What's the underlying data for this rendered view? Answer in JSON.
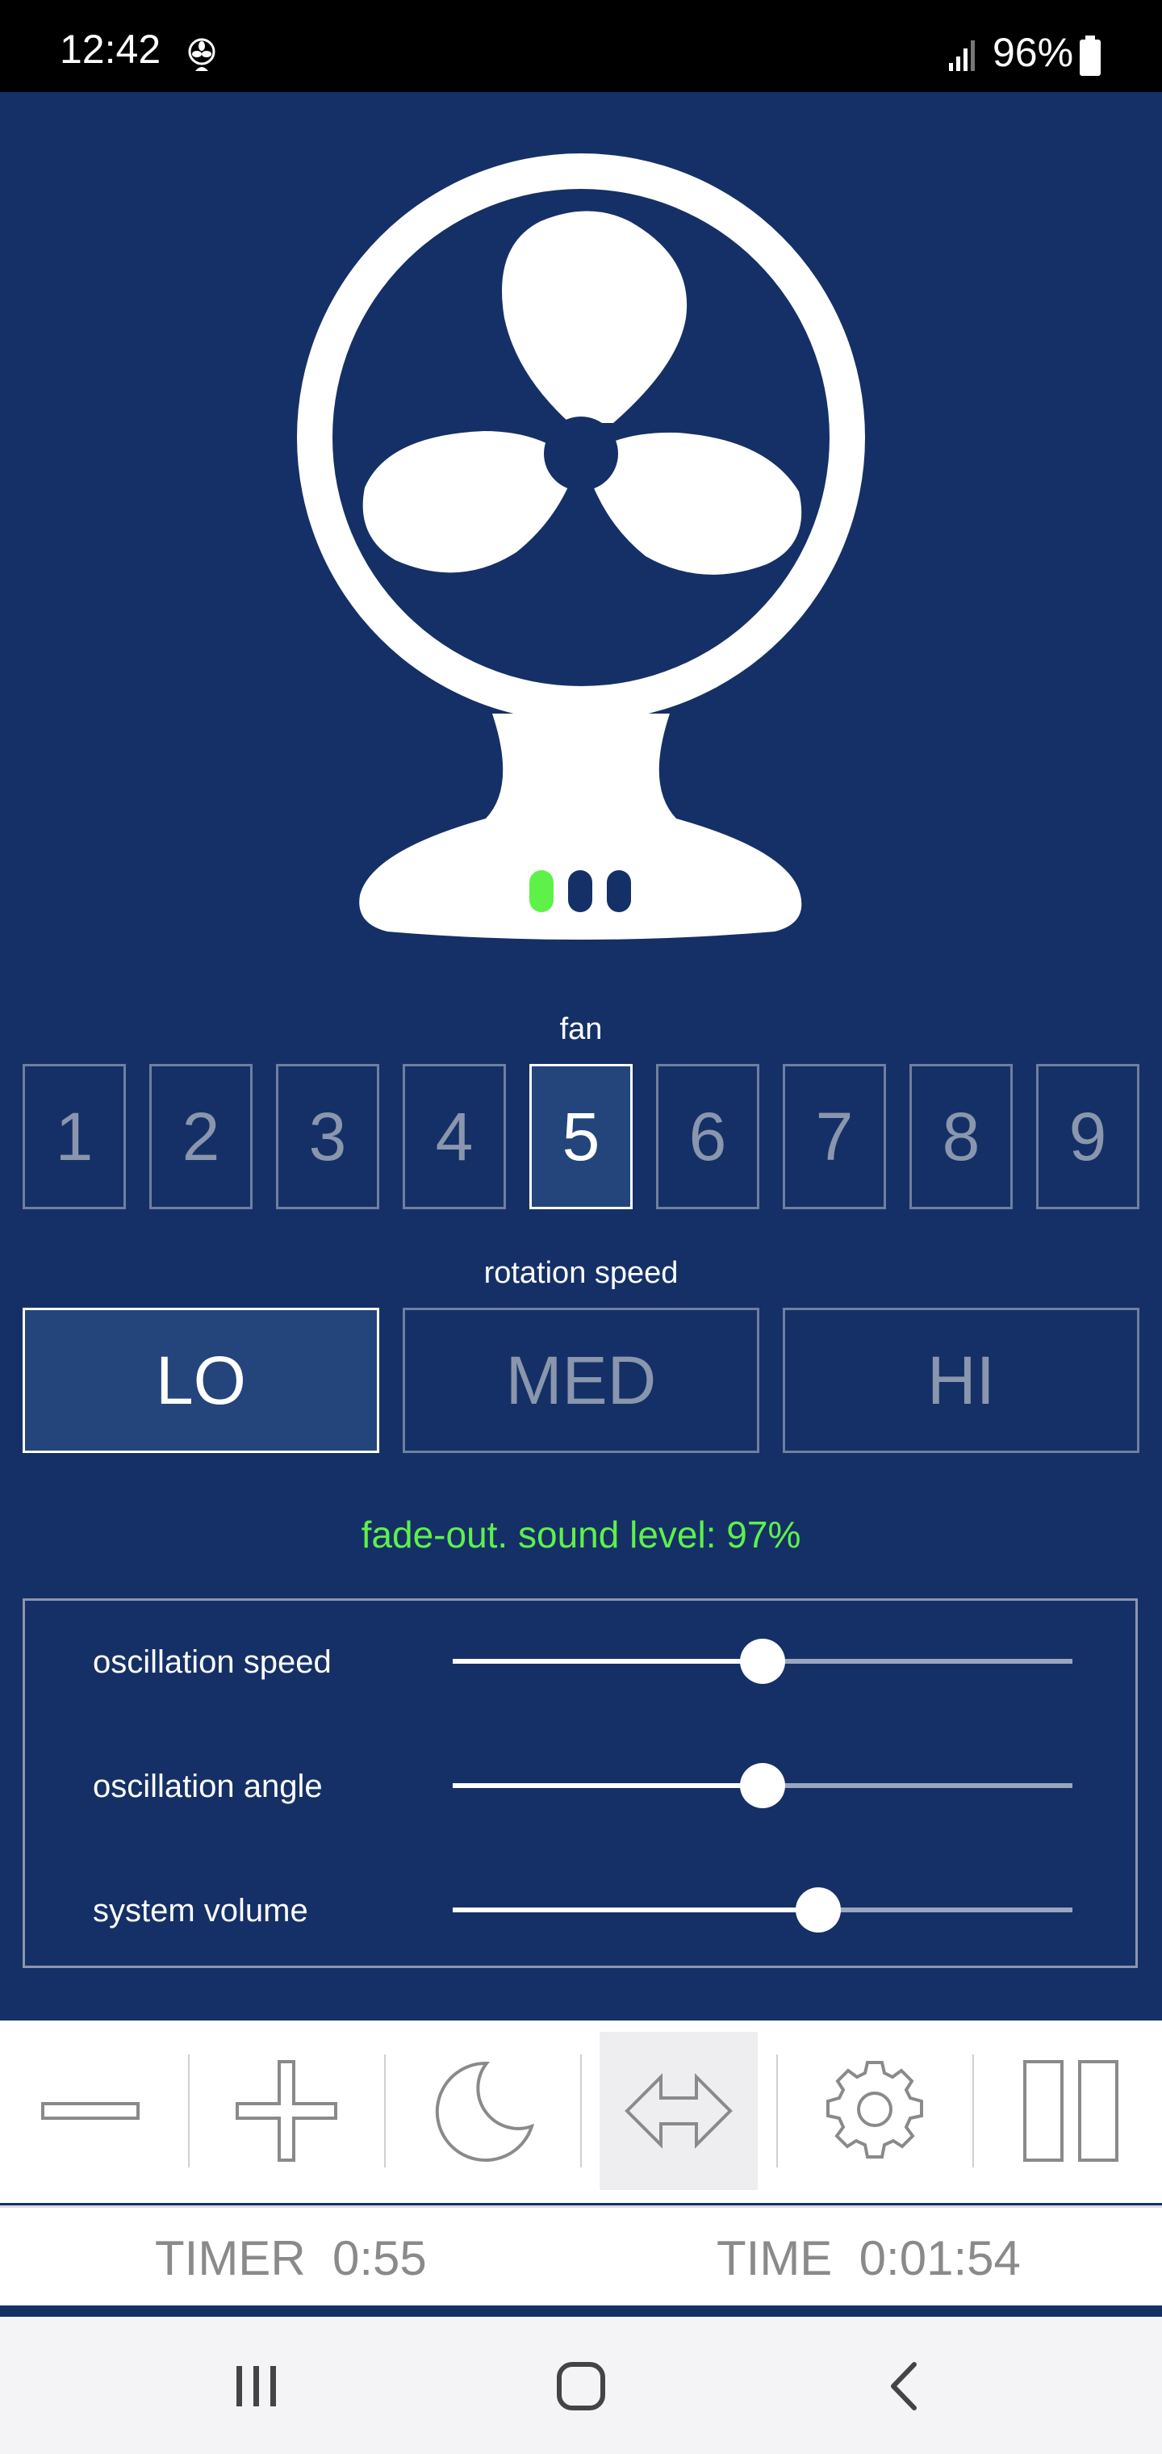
{
  "status_bar": {
    "time": "12:42",
    "battery": "96%",
    "icons": [
      "fan-icon",
      "signal-icon",
      "battery-icon"
    ]
  },
  "fan": {
    "label": "fan",
    "levels": [
      "1",
      "2",
      "3",
      "4",
      "5",
      "6",
      "7",
      "8",
      "9"
    ],
    "selected": "5",
    "indicator_lights": [
      "green",
      "off",
      "off"
    ]
  },
  "rotation": {
    "label": "rotation speed",
    "options": [
      "LO",
      "MED",
      "HI"
    ],
    "selected": "LO"
  },
  "fade_status": "fade-out. sound level: 97%",
  "sliders": [
    {
      "label": "oscillation speed",
      "value": 0.5
    },
    {
      "label": "oscillation angle",
      "value": 0.5
    },
    {
      "label": "system volume",
      "value": 0.59
    }
  ],
  "toolbar": {
    "buttons": [
      "minus-icon",
      "plus-icon",
      "moon-icon",
      "oscillation-arrows-icon",
      "gear-icon",
      "pause-icon"
    ],
    "selected": "oscillation-arrows-icon"
  },
  "timer": {
    "timer_text": "TIMER  0:55",
    "time_text": "TIME  0:01:54"
  },
  "navigation": [
    "recent-apps-icon",
    "home-icon",
    "back-icon"
  ],
  "colors": {
    "background": "#153066",
    "accent_green": "#5ef14a",
    "inactive_text": "#8a96ad",
    "active_button_bg": "#24457b"
  }
}
